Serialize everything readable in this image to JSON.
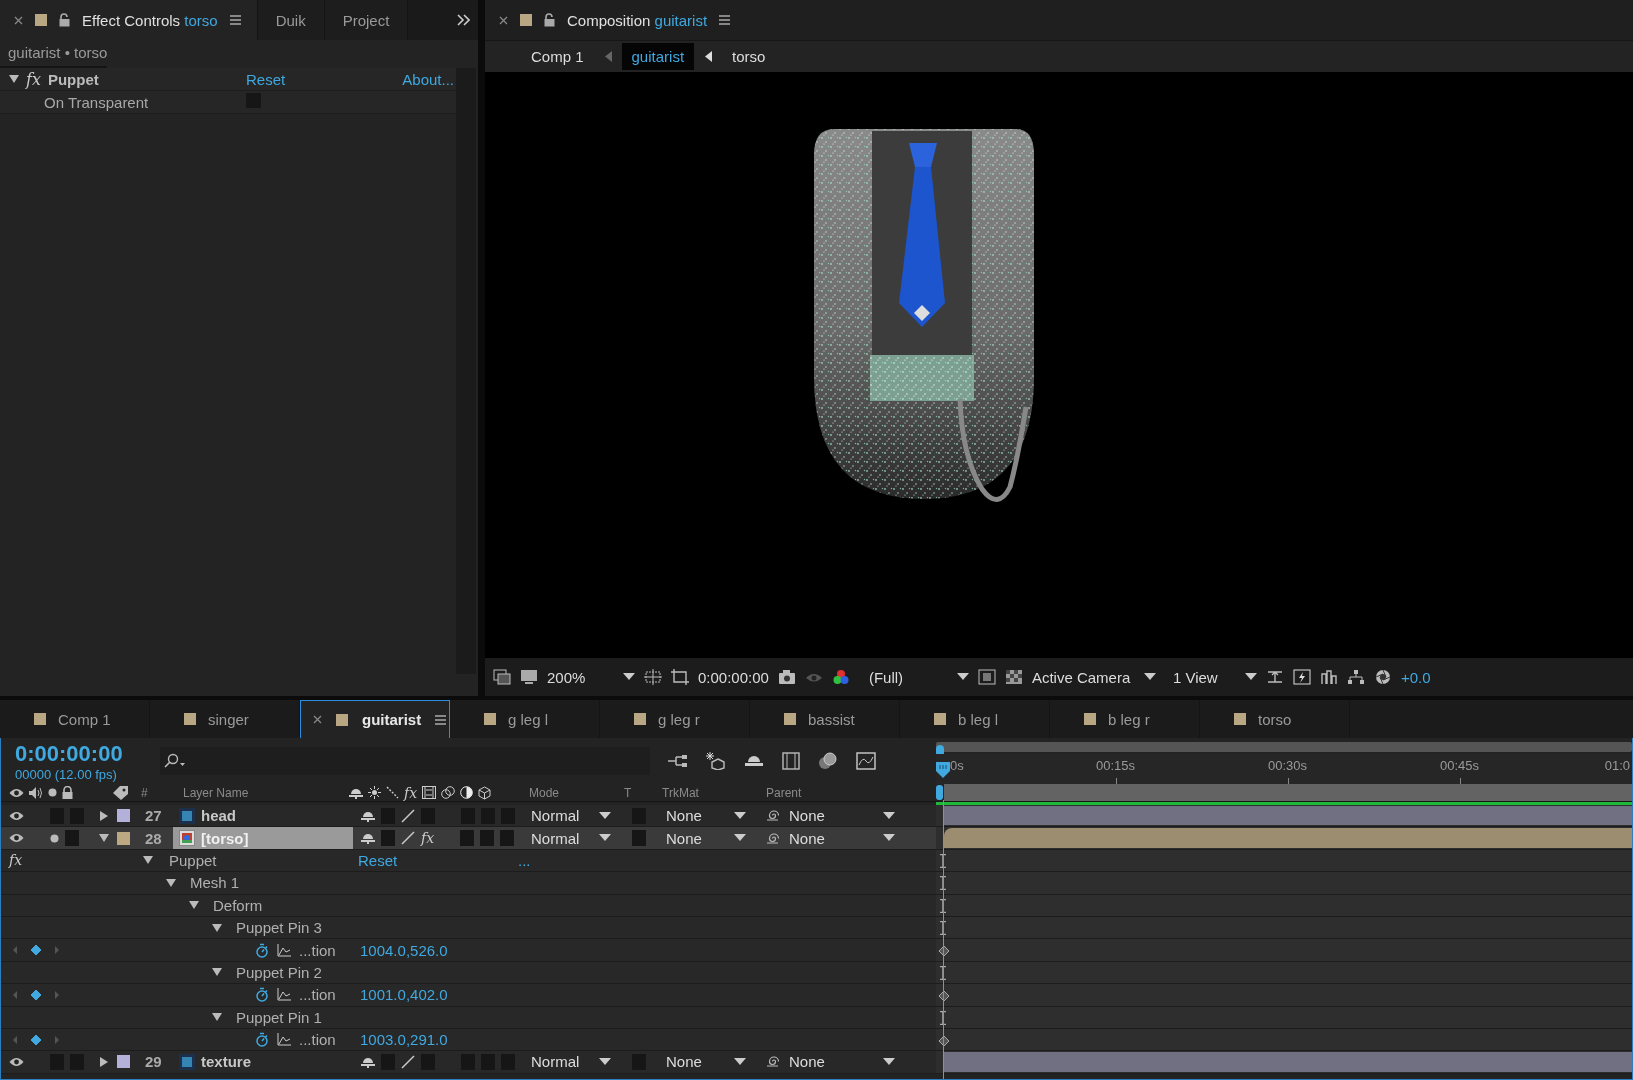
{
  "effect_controls": {
    "tabs": [
      {
        "label": "Effect Controls",
        "target": "torso",
        "selected": true
      },
      {
        "label": "Duik",
        "selected": false
      },
      {
        "label": "Project",
        "selected": false
      }
    ],
    "breadcrumb": "guitarist • torso",
    "effect": {
      "badge": "fx",
      "name": "Puppet",
      "expanded": true,
      "reset": "Reset",
      "about": "About...",
      "properties": [
        {
          "name": "On Transparent",
          "checked": false
        }
      ]
    }
  },
  "composition": {
    "tab": {
      "label": "Composition",
      "target": "guitarist"
    },
    "breadcrumbs": [
      {
        "label": "Comp 1",
        "selected": false
      },
      {
        "label": "guitarist",
        "selected": true
      },
      {
        "label": "torso",
        "selected": false
      }
    ],
    "toolbar": {
      "zoom": "200%",
      "timecode": "0:00:00:00",
      "resolution": "(Full)",
      "camera": "Active Camera",
      "views": "1 View",
      "exposure": "+0.0"
    }
  },
  "timeline": {
    "tabs": [
      {
        "label": "Comp 1",
        "selected": false
      },
      {
        "label": "singer",
        "selected": false
      },
      {
        "label": "guitarist",
        "selected": true
      },
      {
        "label": "g leg l",
        "selected": false
      },
      {
        "label": "g leg r",
        "selected": false
      },
      {
        "label": "bassist",
        "selected": false
      },
      {
        "label": "b leg l",
        "selected": false
      },
      {
        "label": "b leg r",
        "selected": false
      },
      {
        "label": "torso",
        "selected": false
      }
    ],
    "timecode": "0:00:00:00",
    "frame_info": "00000 (12.00 fps)",
    "columns": {
      "number": "#",
      "layer_name": "Layer Name",
      "effects_switch": "fx",
      "mode": "Mode",
      "preserve": "T",
      "track_matte": "TrkMat",
      "parent": "Parent"
    },
    "ruler": [
      "0s",
      "00:15s",
      "00:30s",
      "00:45s",
      "01:0"
    ],
    "layers": [
      {
        "number": "27",
        "name": "head",
        "kind": "psd",
        "color": "#b3b1d9",
        "selected": false,
        "expanded": false,
        "solo": false,
        "mode": "Normal",
        "track_matte": "None",
        "parent": "None"
      },
      {
        "number": "28",
        "name": "[torso]",
        "kind": "comp",
        "color": "#bca882",
        "selected": true,
        "expanded": true,
        "solo": true,
        "effects_switch": "fx",
        "mode": "Normal",
        "track_matte": "None",
        "parent": "None",
        "children": [
          {
            "kind": "effect",
            "badge": "fx",
            "name": "Puppet",
            "expanded": true,
            "reset": "Reset",
            "options": "...",
            "children": [
              {
                "kind": "group",
                "name": "Mesh 1",
                "expanded": true,
                "children": [
                  {
                    "kind": "group",
                    "name": "Deform",
                    "expanded": true,
                    "children": [
                      {
                        "kind": "group",
                        "name": "Puppet Pin 3",
                        "expanded": true,
                        "children": [
                          {
                            "kind": "property",
                            "name": "...tion",
                            "value": "1004.0,526.0",
                            "keyframe": true
                          }
                        ]
                      },
                      {
                        "kind": "group",
                        "name": "Puppet Pin 2",
                        "expanded": true,
                        "children": [
                          {
                            "kind": "property",
                            "name": "...tion",
                            "value": "1001.0,402.0",
                            "keyframe": true
                          }
                        ]
                      },
                      {
                        "kind": "group",
                        "name": "Puppet Pin 1",
                        "expanded": true,
                        "children": [
                          {
                            "kind": "property",
                            "name": "...tion",
                            "value": "1003.0,291.0",
                            "keyframe": true
                          }
                        ]
                      }
                    ]
                  }
                ]
              }
            ]
          }
        ]
      },
      {
        "number": "29",
        "name": "texture",
        "kind": "psd",
        "color": "#b3b1d9",
        "selected": false,
        "expanded": false,
        "solo": false,
        "mode": "Normal",
        "track_matte": "None",
        "parent": "None"
      }
    ]
  }
}
